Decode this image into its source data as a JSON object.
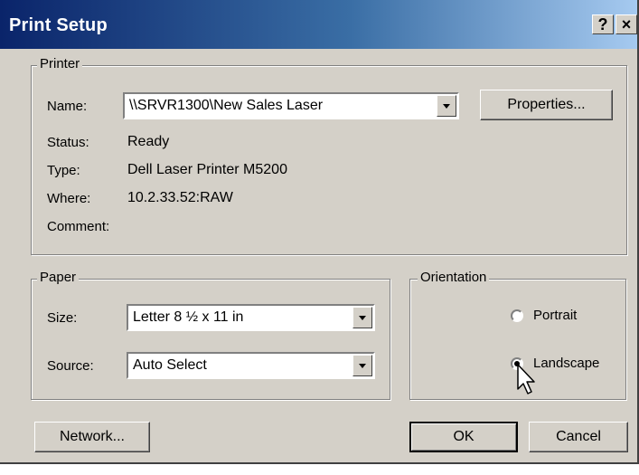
{
  "window": {
    "title": "Print Setup",
    "help_button": "?",
    "close_button": "×"
  },
  "printer": {
    "group_label": "Printer",
    "name_label": "Name:",
    "name_value": "\\\\SRVR1300\\New Sales Laser",
    "properties_button": "Properties...",
    "status_label": "Status:",
    "status_value": "Ready",
    "type_label": "Type:",
    "type_value": "Dell Laser Printer M5200",
    "where_label": "Where:",
    "where_value": "10.2.33.52:RAW",
    "comment_label": "Comment:",
    "comment_value": ""
  },
  "paper": {
    "group_label": "Paper",
    "size_label": "Size:",
    "size_value": "Letter 8 ½ x 11 in",
    "source_label": "Source:",
    "source_value": "Auto Select"
  },
  "orientation": {
    "group_label": "Orientation",
    "portrait_label": "Portrait",
    "landscape_label": "Landscape",
    "selected": "Landscape"
  },
  "buttons": {
    "network": "Network...",
    "ok": "OK",
    "cancel": "Cancel"
  },
  "icons": {
    "dropdown": "chevron-down-icon",
    "cursor": "mouse-pointer-icon"
  }
}
